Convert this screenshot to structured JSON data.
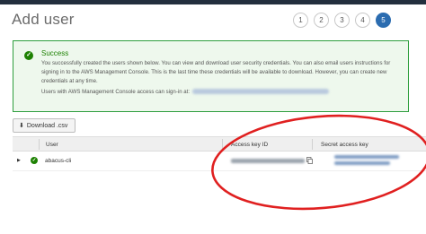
{
  "header": {
    "title": "Add user"
  },
  "steps": [
    "1",
    "2",
    "3",
    "4",
    "5"
  ],
  "alert": {
    "title": "Success",
    "body": "You successfully created the users shown below. You can view and download user security credentials. You can also email users instructions for signing in to the AWS Management Console. This is the last time these credentials will be available to download. However, you can create new credentials at any time.",
    "signin_label": "Users with AWS Management Console access can sign-in at:"
  },
  "toolbar": {
    "download_label": "Download .csv"
  },
  "table": {
    "columns": [
      "User",
      "Access key ID",
      "Secret access key"
    ],
    "rows": [
      {
        "user": "abacus-cli"
      }
    ]
  },
  "colors": {
    "success": "#1d8102",
    "accent": "#2b6cb0",
    "annotation": "#e02020"
  }
}
